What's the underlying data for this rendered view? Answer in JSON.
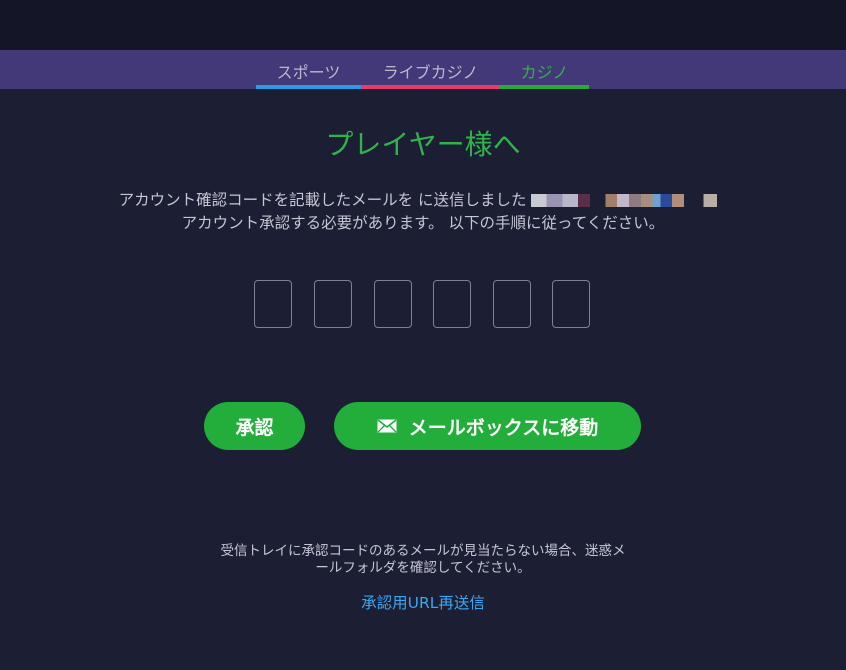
{
  "tabs": [
    {
      "label": "スポーツ",
      "color": "#2b9be6"
    },
    {
      "label": "ライブカジノ",
      "color": "#e83a6a"
    },
    {
      "label": "カジノ",
      "color": "#29a93c"
    }
  ],
  "active_tab": "カジノ",
  "title": "プレイヤー様へ",
  "message_line1": "アカウント確認コードを記載したメールを に送信しました",
  "message_line2": "アカウント承認する必要があります。 以下の手順に従ってください。",
  "code_boxes": [
    "",
    "",
    "",
    "",
    "",
    ""
  ],
  "buttons": {
    "approve_label": "承認",
    "mailbox_label": "メールボックスに移動",
    "mailbox_icon": "mail-icon"
  },
  "note_line1": "受信トレイに承認コードのあるメールが見当たらない場合、迷惑メ",
  "note_line2": "ールフォルダを確認してください。",
  "resend_link": "承認用URL再送信",
  "colors": {
    "accent_green": "#2fb34a",
    "button_green": "#23ad3a",
    "link_blue": "#3aa6f0",
    "tab_bar": "#433878",
    "background": "#1c1f33"
  }
}
